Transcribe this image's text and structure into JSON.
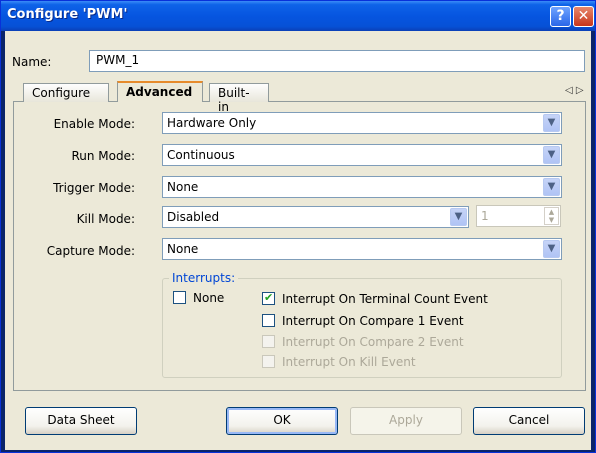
{
  "window": {
    "title": "Configure 'PWM'",
    "help_glyph": "?",
    "close_glyph": "✕"
  },
  "name": {
    "label": "Name:",
    "value": "PWM_1"
  },
  "tabs": [
    {
      "label": "Configure",
      "active": false
    },
    {
      "label": "Advanced",
      "active": true
    },
    {
      "label": "Built-in",
      "active": false
    }
  ],
  "tab_arrows": "◁ ▷",
  "fields": {
    "enable_mode": {
      "label": "Enable Mode:",
      "value": "Hardware Only"
    },
    "run_mode": {
      "label": "Run Mode:",
      "value": "Continuous"
    },
    "trigger_mode": {
      "label": "Trigger Mode:",
      "value": "None"
    },
    "kill_mode": {
      "label": "Kill Mode:",
      "value": "Disabled",
      "spin_value": "1"
    },
    "capture_mode": {
      "label": "Capture Mode:",
      "value": "None"
    }
  },
  "interrupts": {
    "title": "Interrupts:",
    "items": [
      {
        "label": "None",
        "checked": false,
        "enabled": true
      },
      {
        "label": "Interrupt On Terminal Count Event",
        "checked": true,
        "enabled": true
      },
      {
        "label": "Interrupt On Compare 1 Event",
        "checked": false,
        "enabled": true
      },
      {
        "label": "Interrupt On Compare 2 Event",
        "checked": false,
        "enabled": false
      },
      {
        "label": "Interrupt On Kill Event",
        "checked": false,
        "enabled": false
      }
    ]
  },
  "buttons": {
    "datasheet": "Data Sheet",
    "ok": "OK",
    "apply": "Apply",
    "cancel": "Cancel"
  },
  "icons": {
    "dropdown": "chevron-down-icon",
    "checkmark": "checkmark-icon"
  }
}
